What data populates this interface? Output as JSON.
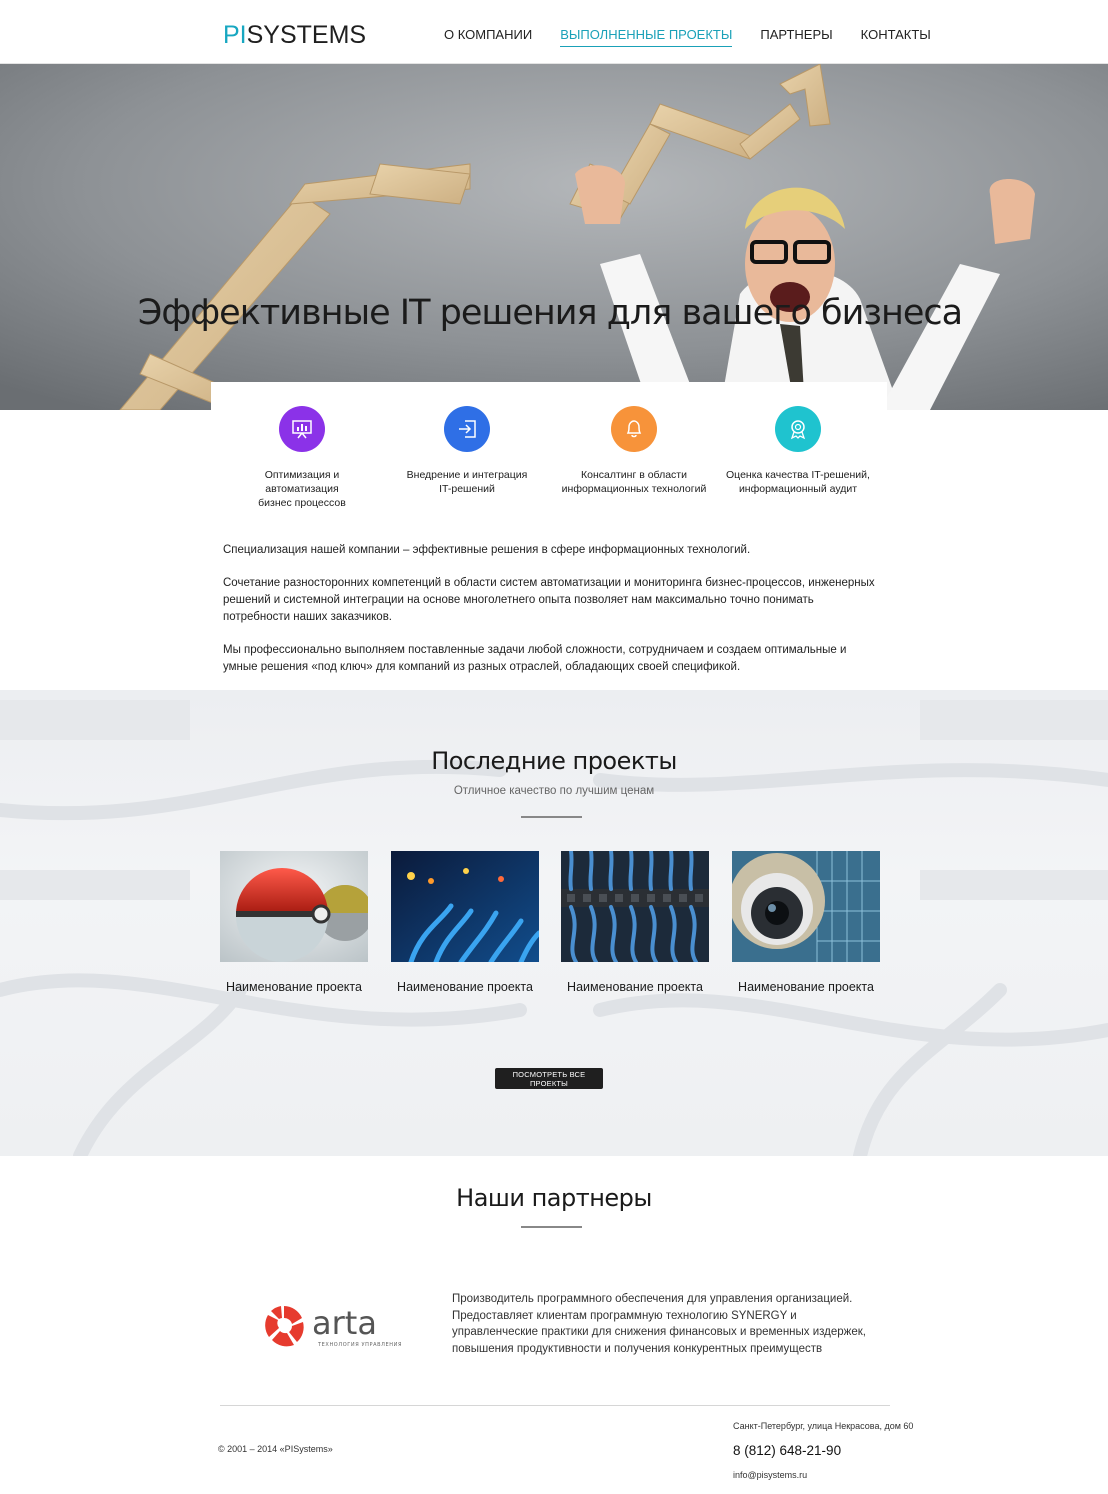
{
  "header": {
    "logo_pi": "PI",
    "logo_systems": "SYSTEMS",
    "nav": [
      {
        "label": "О КОМПАНИИ",
        "active": false
      },
      {
        "label": "ВЫПОЛНЕННЫЕ ПРОЕКТЫ",
        "active": true
      },
      {
        "label": "ПАРТНЕРЫ",
        "active": false
      },
      {
        "label": "КОНТАКТЫ",
        "active": false
      }
    ]
  },
  "hero": {
    "title": "Эффективные IT решения для вашего бизнеса"
  },
  "services": [
    {
      "line1": "Оптимизация и автоматизация",
      "line2": "бизнес процессов",
      "icon": "presentation-chart-icon",
      "color": "#8b32e8"
    },
    {
      "line1": "Внедрение и интеграция",
      "line2": "IT-решений",
      "icon": "sign-in-arrow-icon",
      "color": "#2f6fe6"
    },
    {
      "line1": "Консалтинг в области",
      "line2": "информационных технологий",
      "icon": "bell-icon",
      "color": "#f7933a"
    },
    {
      "line1": "Оценка качества IT-решений,",
      "line2": "информационный аудит",
      "icon": "award-medal-icon",
      "color": "#1fc3cf"
    }
  ],
  "intro": {
    "p1": "Специализация нашей компании –  эффективные решения в сфере информационных технологий.",
    "p2": "Сочетание разносторонних компетенций в области систем автоматизации и мониторинга бизнес-процессов, инженерных решений и системной интеграции на основе многолетнего опыта позволяет нам максимально точно понимать потребности наших заказчиков.",
    "p3": "Мы профессионально выполняем поставленные задачи любой сложности, сотрудничаем и создаем оптимальные и умные решения «под ключ» для компаний из разных отраслей, обладающих своей спецификой."
  },
  "projects": {
    "title": "Последние проекты",
    "subtitle": "Отличное качество по лучшим ценам",
    "items": [
      {
        "name": "Наименование проекта"
      },
      {
        "name": "Наименование проекта"
      },
      {
        "name": "Наименование проекта"
      },
      {
        "name": "Наименование проекта"
      }
    ],
    "button": "ПОСМОТРЕТЬ ВСЕ ПРОЕКТЫ"
  },
  "partners": {
    "title": "Наши партнеры",
    "logo_text": "arta",
    "logo_tagline": "ТЕХНОЛОГИЯ УПРАВЛЕНИЯ",
    "logo_color": "#e63b2e",
    "description": "Производитель программного обеспечения для управления организацией. Предоставляет клиентам программную технологию SYNERGY и управленческие практики для снижения финансовых и временных издержек, повышения продуктивности и получения конкурентных преимуществ"
  },
  "footer": {
    "copyright": "© 2001 – 2014 «PISystems»",
    "address": "Санкт-Петербург, улица Некрасова, дом 60",
    "phone": "8 (812) 648-21-90",
    "email": "info@pisystems.ru"
  }
}
